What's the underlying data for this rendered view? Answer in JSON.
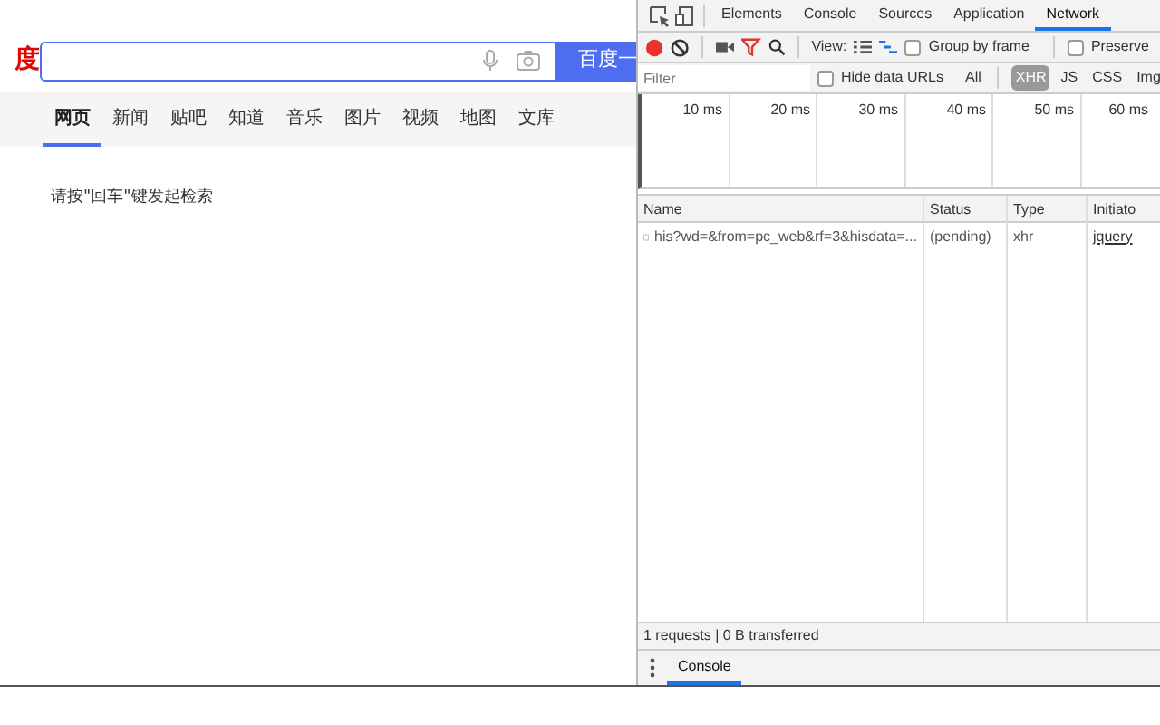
{
  "page": {
    "logo": "度",
    "search_button": "百度一",
    "tabs": [
      {
        "label": "网页",
        "selected": true
      },
      {
        "label": "新闻",
        "selected": false
      },
      {
        "label": "贴吧",
        "selected": false
      },
      {
        "label": "知道",
        "selected": false
      },
      {
        "label": "音乐",
        "selected": false
      },
      {
        "label": "图片",
        "selected": false
      },
      {
        "label": "视频",
        "selected": false
      },
      {
        "label": "地图",
        "selected": false
      },
      {
        "label": "文库",
        "selected": false
      }
    ],
    "hint": "请按\"回车\"键发起检索"
  },
  "devtools": {
    "tabs": [
      {
        "label": "Elements",
        "selected": false
      },
      {
        "label": "Console",
        "selected": false
      },
      {
        "label": "Sources",
        "selected": false
      },
      {
        "label": "Application",
        "selected": false
      },
      {
        "label": "Network",
        "selected": true
      }
    ],
    "toolbar": {
      "recording": true,
      "view_label": "View:",
      "group_by_frame": {
        "label": "Group by frame",
        "checked": false
      },
      "preserve": {
        "label": "Preserve",
        "checked": false
      }
    },
    "filter": {
      "placeholder": "Filter",
      "hide_data_urls": {
        "label": "Hide data URLs",
        "checked": false
      },
      "types": [
        {
          "label": "All",
          "selected": false
        },
        {
          "label": "XHR",
          "selected": true
        },
        {
          "label": "JS",
          "selected": false
        },
        {
          "label": "CSS",
          "selected": false
        },
        {
          "label": "Img",
          "selected": false
        }
      ]
    },
    "timeline_ticks": [
      "10 ms",
      "20 ms",
      "30 ms",
      "40 ms",
      "50 ms",
      "60 ms"
    ],
    "table": {
      "columns": [
        "Name",
        "Status",
        "Type",
        "Initiato"
      ],
      "rows": [
        {
          "name": "his?wd=&from=pc_web&rf=3&hisdata=...",
          "status": "(pending)",
          "type": "xhr",
          "initiator": "jquery"
        }
      ]
    },
    "status_bar": "1 requests | 0 B transferred",
    "drawer_tabs": [
      {
        "label": "Console",
        "selected": true
      }
    ]
  }
}
